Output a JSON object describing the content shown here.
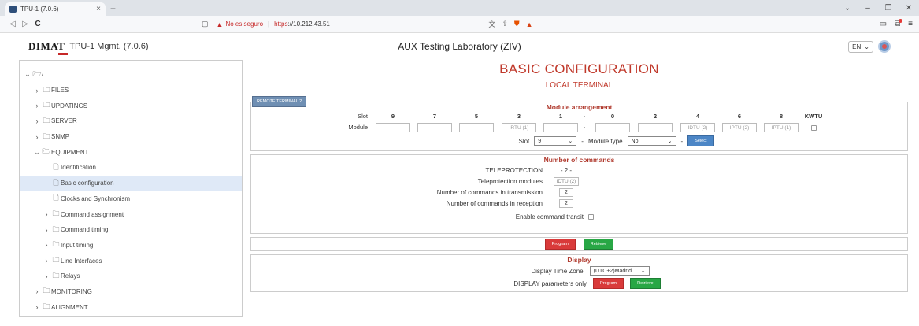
{
  "browser": {
    "tab_title": "TPU-1 (7.0.6)",
    "tab_close": "×",
    "new_tab": "+",
    "security_label": "No es seguro",
    "url_scheme": "https",
    "url_sep": "://",
    "url_host": "10.212.43.51"
  },
  "header": {
    "logo": "DIMAT",
    "app_title": "TPU-1 Mgmt. (7.0.6)",
    "center_title": "AUX Testing Laboratory (ZIV)",
    "language": "EN"
  },
  "sidebar": {
    "root": "/",
    "items": [
      {
        "label": "FILES"
      },
      {
        "label": "UPDATINGS"
      },
      {
        "label": "SERVER"
      },
      {
        "label": "SNMP"
      },
      {
        "label": "EQUIPMENT"
      },
      {
        "label": "Identification"
      },
      {
        "label": "Basic configuration"
      },
      {
        "label": "Clocks and Synchronism"
      },
      {
        "label": "Command assignment"
      },
      {
        "label": "Command timing"
      },
      {
        "label": "Input timing"
      },
      {
        "label": "Line Interfaces"
      },
      {
        "label": "Relays"
      },
      {
        "label": "MONITORING"
      },
      {
        "label": "ALIGNMENT"
      }
    ]
  },
  "page": {
    "title": "BASIC CONFIGURATION",
    "subtitle": "LOCAL TERMINAL",
    "remote_button": "REMOTE TERMINAL 2"
  },
  "modules": {
    "title": "Module arrangement",
    "slot_label": "Slot",
    "module_label": "Module",
    "slots": [
      "9",
      "7",
      "5",
      "3",
      "1",
      "-",
      "0",
      "2",
      "4",
      "6",
      "8",
      "KWTU"
    ],
    "module_values": [
      "",
      "",
      "",
      "IRTU (1)",
      "",
      "-",
      "",
      "",
      "IDTU (2)",
      "IPTU (2)",
      "IPTU (1)",
      ""
    ],
    "select_slot_label": "Slot",
    "select_slot_value": "9",
    "dash": "-",
    "module_type_label": "Module type",
    "module_type_value": "No",
    "select_button": "Select"
  },
  "commands": {
    "title": "Number of commands",
    "teleprotection_label": "TELEPROTECTION",
    "teleprotection_value": "- 2 -",
    "tp_modules_label": "Teleprotection modules",
    "tp_modules_value": "IDTU (2)",
    "tx_label": "Number of commands in transmission",
    "tx_value": "2",
    "rx_label": "Number of commands in reception",
    "rx_value": "2",
    "transit_label": "Enable command transit"
  },
  "actions": {
    "program": "Program",
    "retrieve": "Retrieve"
  },
  "display": {
    "title": "Display",
    "tz_label": "Display Time Zone",
    "tz_value": "(UTC+2)Madrid",
    "params_label": "DISPLAY parameters only",
    "program": "Program",
    "retrieve": "Retrieve"
  }
}
